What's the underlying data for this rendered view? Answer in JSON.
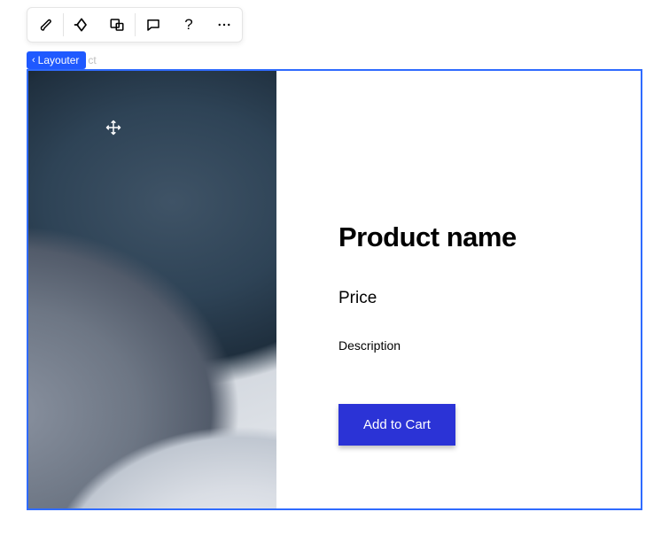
{
  "toolbar": {
    "items": [
      {
        "name": "brush-icon"
      },
      {
        "name": "animation-icon"
      },
      {
        "name": "responsive-icon"
      },
      {
        "name": "comment-icon"
      },
      {
        "name": "help-icon"
      },
      {
        "name": "more-icon"
      }
    ]
  },
  "breadcrumb": {
    "label": "Layouter",
    "faded": "ct"
  },
  "product": {
    "title": "Product name",
    "price": "Price",
    "description": "Description",
    "cta_label": "Add to Cart"
  },
  "colors": {
    "selection": "#2f6bff",
    "tag": "#1f59ff",
    "cta": "#2b33d6"
  }
}
